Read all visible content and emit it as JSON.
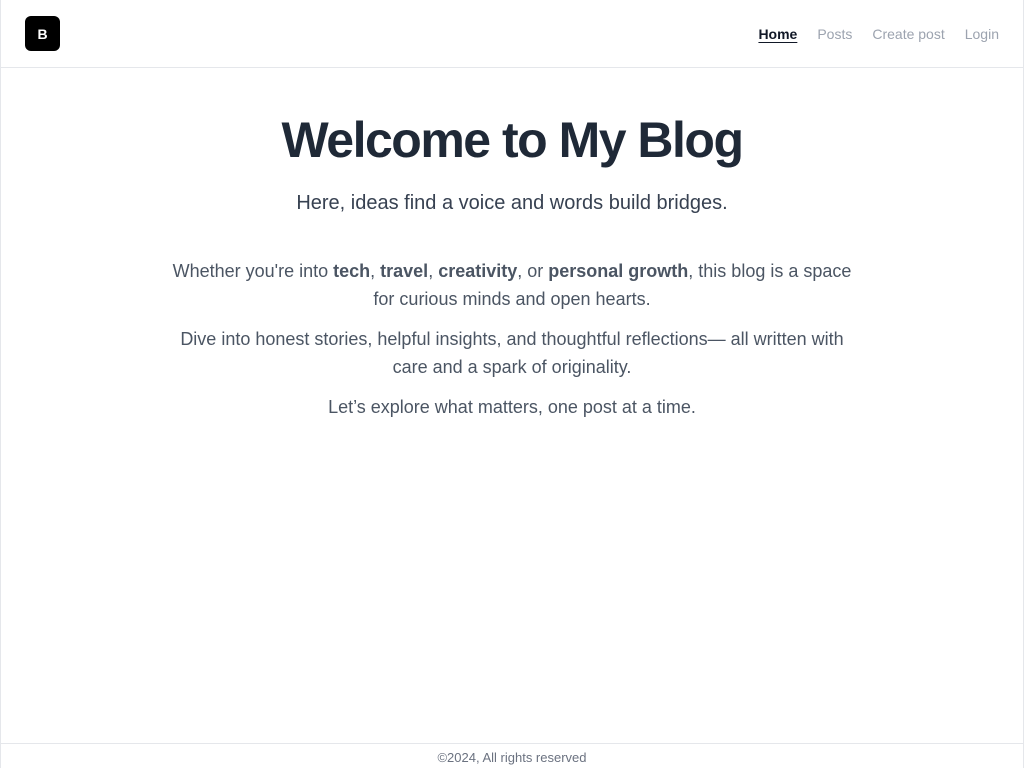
{
  "header": {
    "logo_letter": "B",
    "nav": [
      {
        "label": "Home",
        "active": true
      },
      {
        "label": "Posts",
        "active": false
      },
      {
        "label": "Create post",
        "active": false
      },
      {
        "label": "Login",
        "active": false
      }
    ]
  },
  "hero": {
    "title": "Welcome to My Blog",
    "subtitle": "Here, ideas find a voice and words build bridges."
  },
  "intro": {
    "p1_prefix": "Whether you're into ",
    "topic_1": "tech",
    "sep_1": ", ",
    "topic_2": "travel",
    "sep_2": ", ",
    "topic_3": "creativity",
    "sep_3": ", or ",
    "topic_4": "personal growth",
    "p1_suffix": ", this blog is a space for curious minds and open hearts.",
    "p2": "Dive into honest stories, helpful insights, and thoughtful reflections— all written with care and a spark of originality.",
    "p3": "Let’s explore what matters, one post at a time."
  },
  "footer": {
    "copyright": "©2024, All rights reserved"
  },
  "colors": {
    "logo_bg": "#000000",
    "title": "#1f2937",
    "body_text": "#4b5563",
    "nav_inactive": "#9ca3af",
    "nav_active": "#111827",
    "border": "#e5e7eb"
  }
}
